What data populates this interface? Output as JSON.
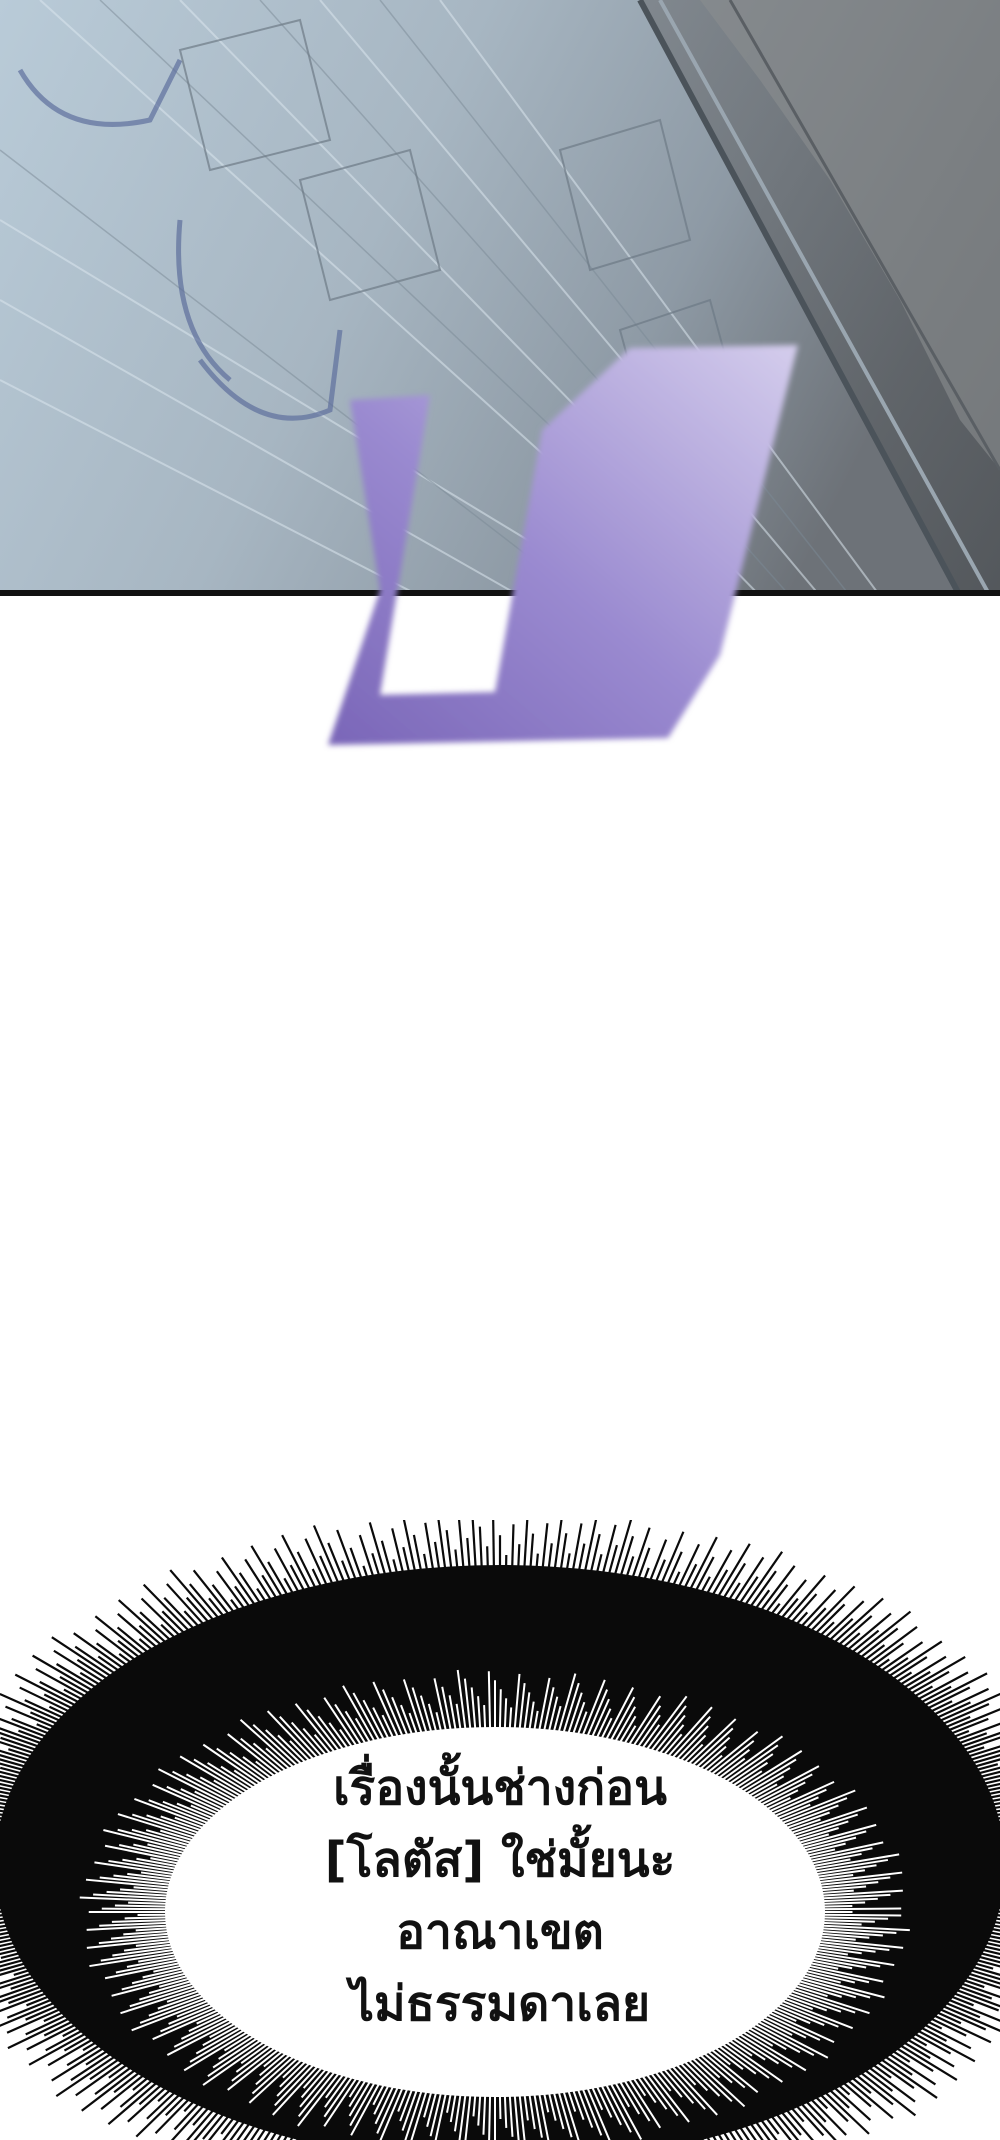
{
  "comic": {
    "scene": {
      "palette": {
        "panel_light": "#b9cbd8",
        "panel_mid": "#8e9aa5",
        "panel_dark": "#5f646a",
        "sfx_purple": "#8c78c8",
        "sfx_lavender": "#c8c0e6",
        "bubble_black": "#0a0a0a"
      }
    },
    "speech_bubble": {
      "lines": [
        "เรื่องนั้นช่างก่อน",
        "[โลตัส] ใช่มั้ยนะ",
        "อาณาเขต",
        "ไม่ธรรมดาเลย"
      ]
    }
  }
}
